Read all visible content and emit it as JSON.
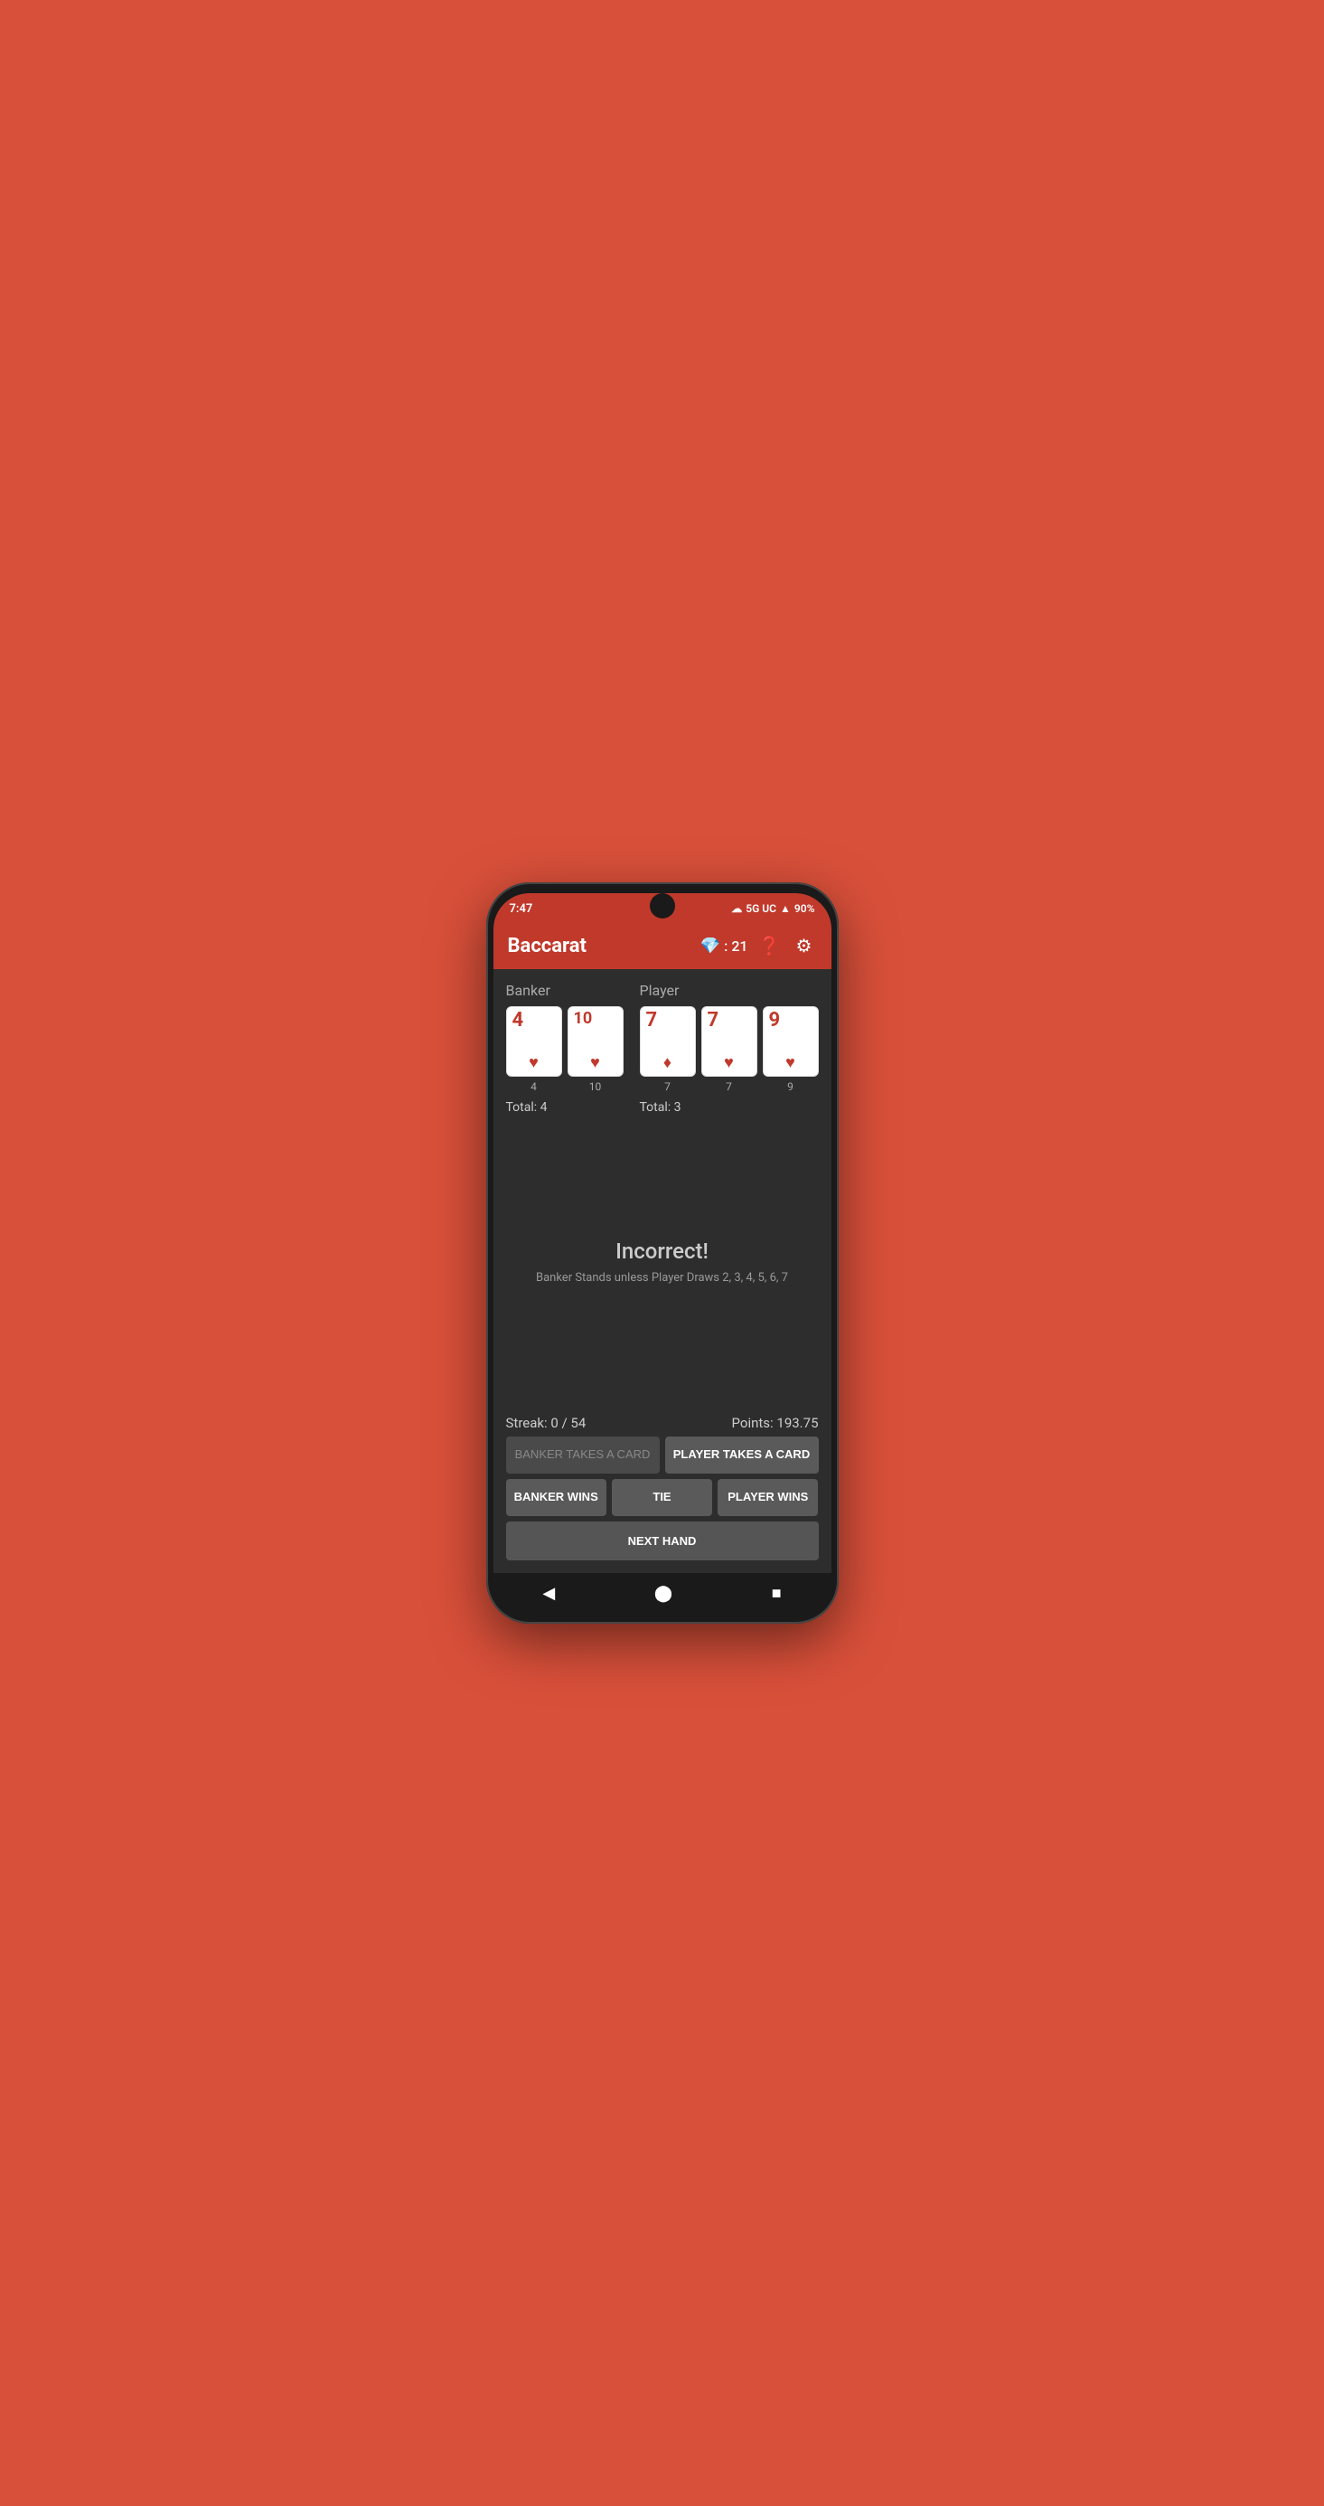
{
  "status_bar": {
    "time": "7:47",
    "network": "5G UC",
    "battery": "90%",
    "cloud_icon": "☁"
  },
  "app_bar": {
    "title": "Baccarat",
    "gem_icon": "💎",
    "gem_score": "21",
    "help_icon": "?",
    "settings_icon": "⚙"
  },
  "banker": {
    "label": "Banker",
    "cards": [
      {
        "value": "4",
        "suit": "♥",
        "number": "4"
      },
      {
        "value": "10",
        "suit": "♥",
        "number": "10"
      }
    ],
    "total_label": "Total: 4"
  },
  "player": {
    "label": "Player",
    "cards": [
      {
        "value": "7",
        "suit": "♦",
        "number": "7"
      },
      {
        "value": "7",
        "suit": "♥",
        "number": "7"
      },
      {
        "value": "9",
        "suit": "♥",
        "number": "9"
      }
    ],
    "total_label": "Total: 3"
  },
  "result": {
    "title": "Incorrect!",
    "subtitle": "Banker Stands unless Player Draws 2, 3, 4, 5, 6, 7"
  },
  "stats": {
    "streak": "Streak: 0 / 54",
    "points": "Points: 193.75"
  },
  "buttons": {
    "banker_takes": "BANKER TAKES A CARD",
    "player_takes": "PLAYER TAKES A CARD",
    "banker_wins": "BANKER WINS",
    "tie": "TIE",
    "player_wins": "PLAYER WINS",
    "next_hand": "NEXT HAND"
  }
}
